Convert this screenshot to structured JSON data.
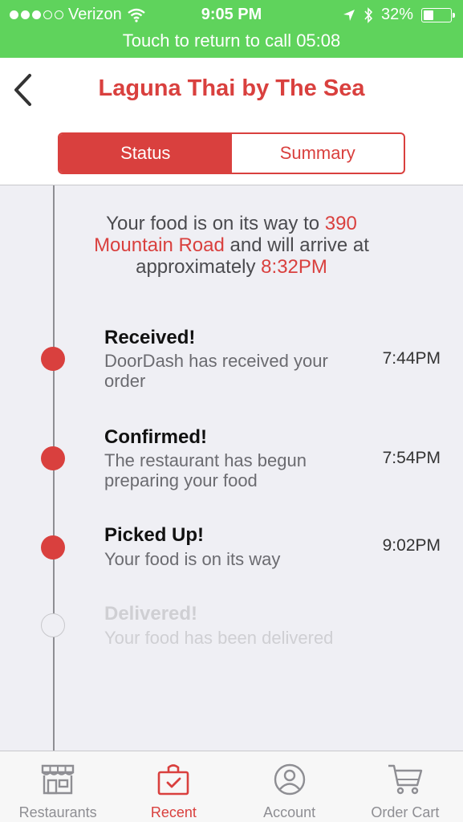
{
  "status_bar": {
    "carrier": "Verizon",
    "time": "9:05 PM",
    "battery": "32%",
    "battery_level": 0.32,
    "call_banner": "Touch to return to call  05:08"
  },
  "header": {
    "title": "Laguna Thai by The Sea"
  },
  "segments": {
    "status": "Status",
    "summary": "Summary"
  },
  "summary": {
    "part1": "Your food is on its way to ",
    "address": "390 Mountain Road",
    "part2": " and will arrive at approximately ",
    "eta": "8:32PM"
  },
  "steps": [
    {
      "title": "Received!",
      "desc": "DoorDash has received your order",
      "time": "7:44PM",
      "done": true
    },
    {
      "title": "Confirmed!",
      "desc": "The restaurant has begun preparing your food",
      "time": "7:54PM",
      "done": true
    },
    {
      "title": "Picked Up!",
      "desc": "Your food is on its way",
      "time": "9:02PM",
      "done": true
    },
    {
      "title": "Delivered!",
      "desc": "Your food has been delivered",
      "time": "",
      "done": false
    }
  ],
  "tabbar": {
    "restaurants": "Restaurants",
    "recent": "Recent",
    "account": "Account",
    "order_cart": "Order Cart"
  },
  "colors": {
    "accent": "#d9403e",
    "call_banner": "#5fd35c"
  }
}
